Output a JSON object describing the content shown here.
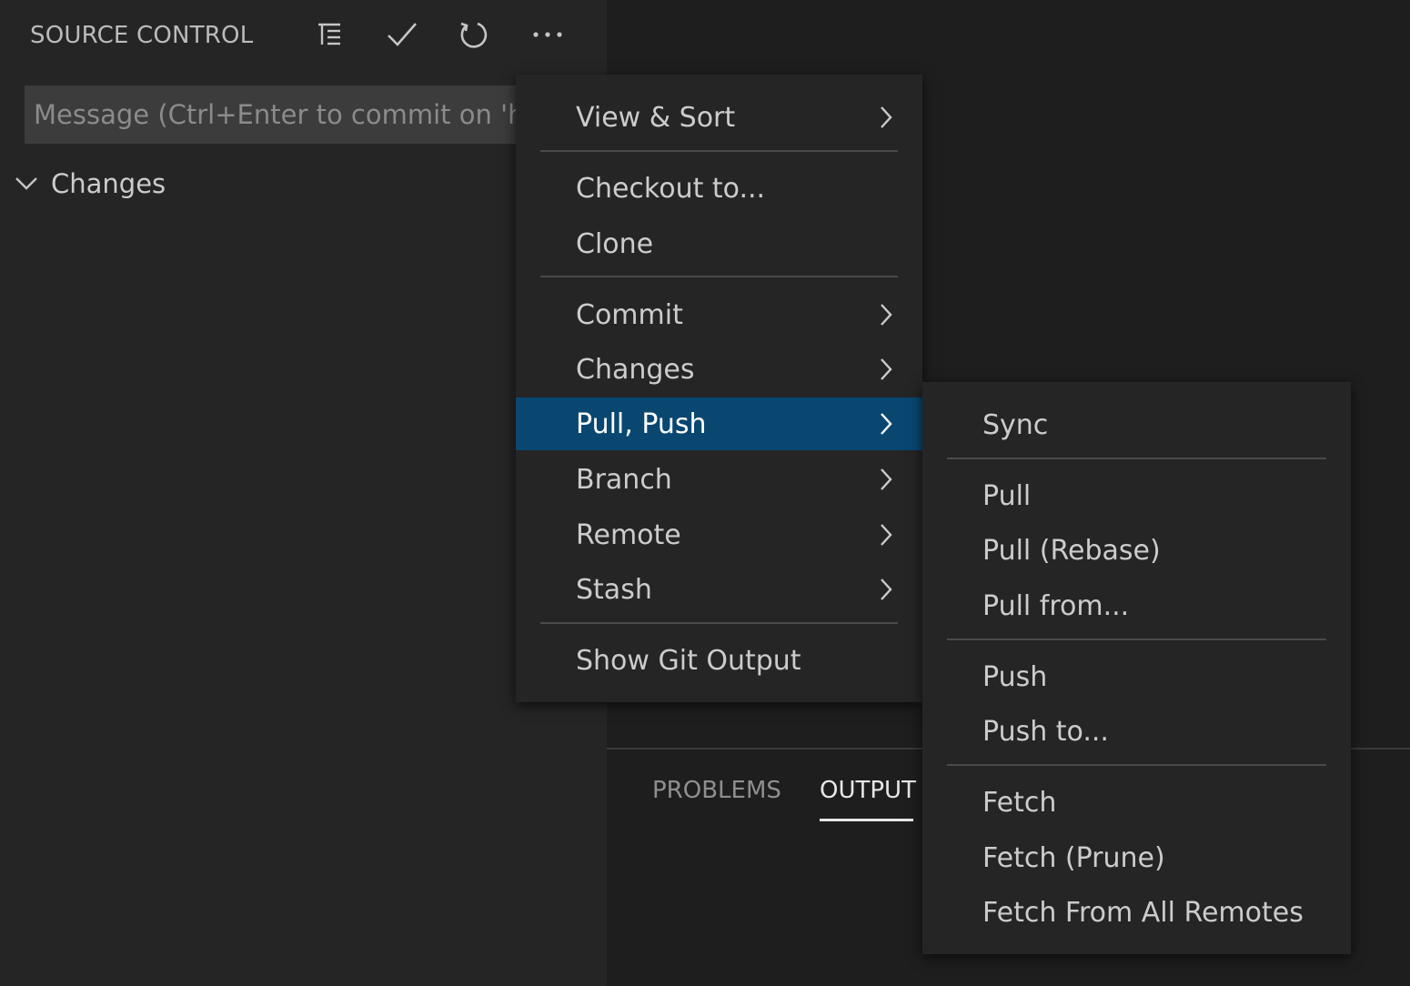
{
  "scm": {
    "title": "SOURCE CONTROL",
    "message_placeholder": "Message (Ctrl+Enter to commit on 'h",
    "changes_label": "Changes"
  },
  "toolbar": {
    "icons": [
      "tree-view-icon",
      "check-icon",
      "refresh-icon",
      "more-icon"
    ]
  },
  "panel": {
    "tabs": [
      {
        "label": "PROBLEMS",
        "active": false
      },
      {
        "label": "OUTPUT",
        "active": true
      }
    ]
  },
  "main_menu": {
    "items": [
      {
        "label": "View & Sort",
        "submenu": true
      },
      {
        "label": "Checkout to...",
        "submenu": false
      },
      {
        "label": "Clone",
        "submenu": false
      },
      {
        "label": "Commit",
        "submenu": true
      },
      {
        "label": "Changes",
        "submenu": true
      },
      {
        "label": "Pull, Push",
        "submenu": true,
        "selected": true
      },
      {
        "label": "Branch",
        "submenu": true
      },
      {
        "label": "Remote",
        "submenu": true
      },
      {
        "label": "Stash",
        "submenu": true
      },
      {
        "label": "Show Git Output",
        "submenu": false
      }
    ]
  },
  "sub_menu": {
    "items": [
      {
        "label": "Sync"
      },
      {
        "label": "Pull"
      },
      {
        "label": "Pull (Rebase)"
      },
      {
        "label": "Pull from..."
      },
      {
        "label": "Push"
      },
      {
        "label": "Push to..."
      },
      {
        "label": "Fetch"
      },
      {
        "label": "Fetch (Prune)"
      },
      {
        "label": "Fetch From All Remotes"
      }
    ]
  },
  "colors": {
    "selection": "#094771",
    "menu_bg": "#252526",
    "editor_bg": "#1e1e1e",
    "input_bg": "#3c3c3c"
  }
}
